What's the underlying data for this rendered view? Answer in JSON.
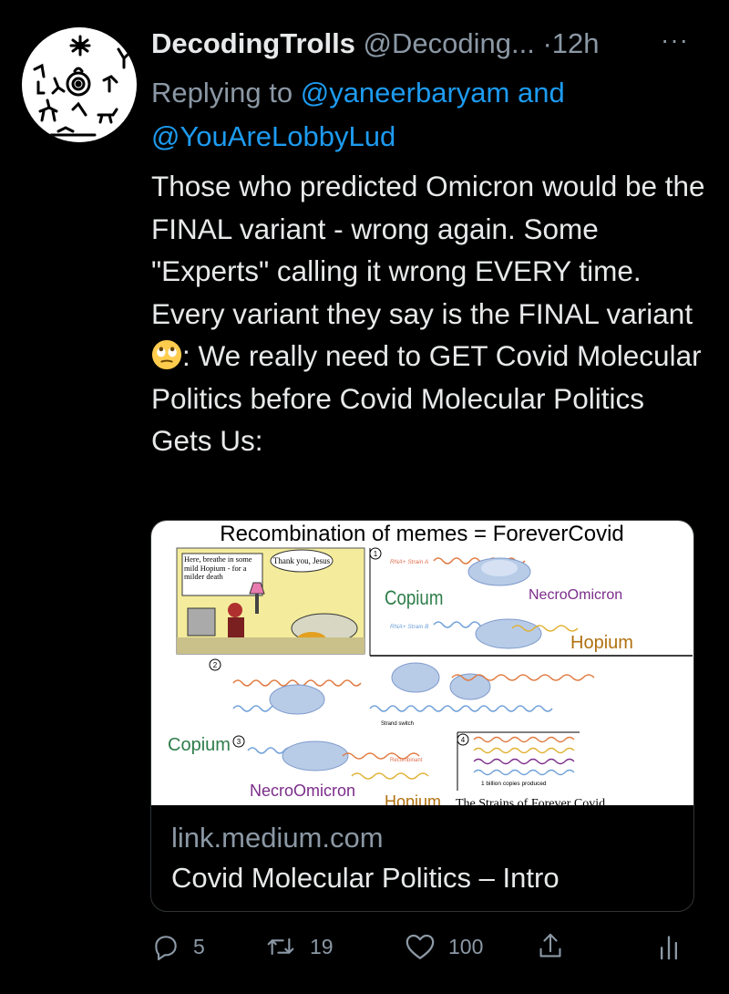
{
  "tweet": {
    "name": "DecodingTrolls",
    "handle": "@Decoding...",
    "dot": "·",
    "time": "12h",
    "more": "···",
    "replying_prefix": "Replying to ",
    "mention1": "@yaneerbaryam",
    "and": " and",
    "mention2": "@YouAreLobbyLud",
    "text_before_emoji": "Those who predicted Omicron would be the FINAL variant - wrong again. Some \"Experts\" calling it wrong EVERY time. Every variant they say is the FINAL variant",
    "text_after_emoji": ": We really need to GET Covid Molecular Politics before Covid Molecular Politics Gets Us:",
    "emoji_name": "face-with-rolling-eyes"
  },
  "card": {
    "image": {
      "title": "Recombination of memes = ForeverCovid",
      "comic_left_text": "Here, breathe in some mild Hopium - for a milder death",
      "comic_right_text": "Thank you, Jesus",
      "step1": "1",
      "step2": "2",
      "step3": "3",
      "step4": "4",
      "rna_a": "RNA+ Strain A",
      "rna_b": "RNA+ Strain B",
      "copium_top": "Copium",
      "necro_top": "NecroOmicron",
      "hopium_top": "Hopium",
      "strand_switch": "Strand switch",
      "copium_bottom": "Copium",
      "recombinant": "Recombinant",
      "necro_bottom": "NecroOmicron",
      "hopium_bottom": "Hopium",
      "copies": "1 billion copies produced",
      "strains_caption": "The Strains of Forever Covid"
    },
    "domain": "link.medium.com",
    "title": "Covid Molecular Politics – Intro"
  },
  "actions": {
    "reply_count": "5",
    "retweet_count": "19",
    "like_count": "100"
  },
  "colors": {
    "background": "#000000",
    "text": "#e7e9ea",
    "secondary": "#8b98a5",
    "accent": "#1d9bf0"
  }
}
